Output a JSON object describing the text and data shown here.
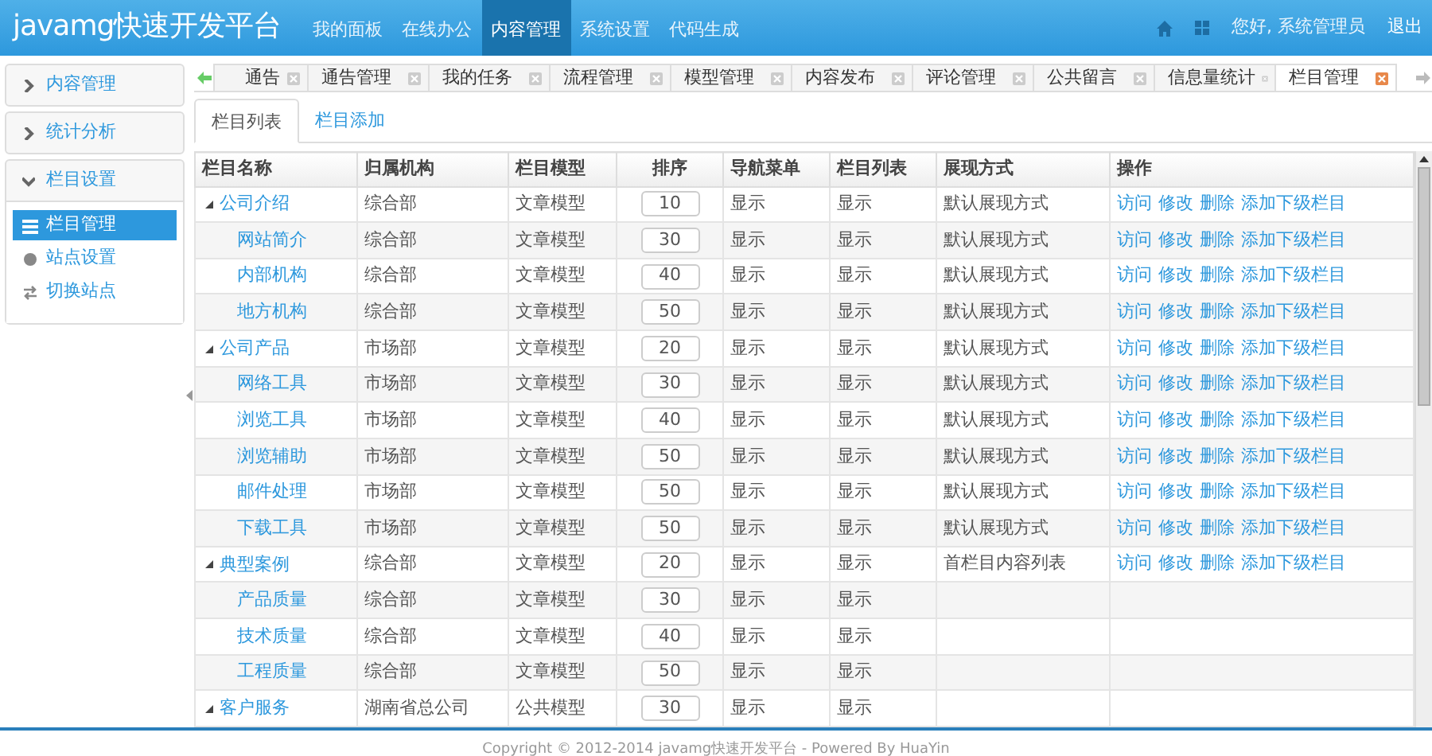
{
  "header": {
    "title": "javamg快速开发平台",
    "nav": [
      {
        "label": "我的面板",
        "selected": false
      },
      {
        "label": "在线办公",
        "selected": false
      },
      {
        "label": "内容管理",
        "selected": true
      },
      {
        "label": "系统设置",
        "selected": false
      },
      {
        "label": "代码生成",
        "selected": false
      }
    ],
    "greeting": "您好, 系统管理员",
    "logout": "退出"
  },
  "sidebar": {
    "panels": [
      {
        "label": "内容管理",
        "expanded": false
      },
      {
        "label": "统计分析",
        "expanded": false
      },
      {
        "label": "栏目设置",
        "expanded": true,
        "items": [
          {
            "label": "栏目管理",
            "selected": true
          },
          {
            "label": "站点设置",
            "selected": false
          },
          {
            "label": "切换站点",
            "selected": false
          }
        ]
      }
    ]
  },
  "tabs": [
    {
      "label": "通告",
      "selected": false
    },
    {
      "label": "通告管理",
      "selected": false
    },
    {
      "label": "我的任务",
      "selected": false
    },
    {
      "label": "流程管理",
      "selected": false
    },
    {
      "label": "模型管理",
      "selected": false
    },
    {
      "label": "内容发布",
      "selected": false
    },
    {
      "label": "评论管理",
      "selected": false
    },
    {
      "label": "公共留言",
      "selected": false
    },
    {
      "label": "信息量统计",
      "selected": false
    },
    {
      "label": "栏目管理",
      "selected": true
    }
  ],
  "subtabs": [
    {
      "label": "栏目列表",
      "selected": true
    },
    {
      "label": "栏目添加",
      "selected": false
    }
  ],
  "table": {
    "columns": [
      "栏目名称",
      "归属机构",
      "栏目模型",
      "排序",
      "导航菜单",
      "栏目列表",
      "展现方式",
      "操作"
    ],
    "rows": [
      {
        "name": "公司介绍",
        "org": "综合部",
        "model": "文章模型",
        "sort": "10",
        "nav": "显示",
        "list": "显示",
        "display": "默认展现方式",
        "ops": [
          "访问",
          "修改",
          "删除",
          "添加下级栏目"
        ],
        "expanded": true,
        "children": [
          {
            "name": "网站简介",
            "org": "综合部",
            "model": "文章模型",
            "sort": "30",
            "nav": "显示",
            "list": "显示",
            "display": "默认展现方式",
            "ops": [
              "访问",
              "修改",
              "删除",
              "添加下级栏目"
            ]
          },
          {
            "name": "内部机构",
            "org": "综合部",
            "model": "文章模型",
            "sort": "40",
            "nav": "显示",
            "list": "显示",
            "display": "默认展现方式",
            "ops": [
              "访问",
              "修改",
              "删除",
              "添加下级栏目"
            ]
          },
          {
            "name": "地方机构",
            "org": "综合部",
            "model": "文章模型",
            "sort": "50",
            "nav": "显示",
            "list": "显示",
            "display": "默认展现方式",
            "ops": [
              "访问",
              "修改",
              "删除",
              "添加下级栏目"
            ]
          }
        ]
      },
      {
        "name": "公司产品",
        "org": "市场部",
        "model": "文章模型",
        "sort": "20",
        "nav": "显示",
        "list": "显示",
        "display": "默认展现方式",
        "ops": [
          "访问",
          "修改",
          "删除",
          "添加下级栏目"
        ],
        "expanded": true,
        "children": [
          {
            "name": "网络工具",
            "org": "市场部",
            "model": "文章模型",
            "sort": "30",
            "nav": "显示",
            "list": "显示",
            "display": "默认展现方式",
            "ops": [
              "访问",
              "修改",
              "删除",
              "添加下级栏目"
            ]
          },
          {
            "name": "浏览工具",
            "org": "市场部",
            "model": "文章模型",
            "sort": "40",
            "nav": "显示",
            "list": "显示",
            "display": "默认展现方式",
            "ops": [
              "访问",
              "修改",
              "删除",
              "添加下级栏目"
            ]
          },
          {
            "name": "浏览辅助",
            "org": "市场部",
            "model": "文章模型",
            "sort": "50",
            "nav": "显示",
            "list": "显示",
            "display": "默认展现方式",
            "ops": [
              "访问",
              "修改",
              "删除",
              "添加下级栏目"
            ]
          },
          {
            "name": "邮件处理",
            "org": "市场部",
            "model": "文章模型",
            "sort": "50",
            "nav": "显示",
            "list": "显示",
            "display": "默认展现方式",
            "ops": [
              "访问",
              "修改",
              "删除",
              "添加下级栏目"
            ]
          },
          {
            "name": "下载工具",
            "org": "市场部",
            "model": "文章模型",
            "sort": "50",
            "nav": "显示",
            "list": "显示",
            "display": "默认展现方式",
            "ops": [
              "访问",
              "修改",
              "删除",
              "添加下级栏目"
            ]
          }
        ]
      },
      {
        "name": "典型案例",
        "org": "综合部",
        "model": "文章模型",
        "sort": "20",
        "nav": "显示",
        "list": "显示",
        "display": "首栏目内容列表",
        "ops": [
          "访问",
          "修改",
          "删除",
          "添加下级栏目"
        ],
        "expanded": true,
        "children": [
          {
            "name": "产品质量",
            "org": "综合部",
            "model": "文章模型",
            "sort": "30",
            "nav": "显示",
            "list": "显示"
          },
          {
            "name": "技术质量",
            "org": "综合部",
            "model": "文章模型",
            "sort": "40",
            "nav": "显示",
            "list": "显示"
          },
          {
            "name": "工程质量",
            "org": "综合部",
            "model": "文章模型",
            "sort": "50",
            "nav": "显示",
            "list": "显示"
          }
        ]
      },
      {
        "name": "客户服务",
        "org": "湖南省总公司",
        "model": "公共模型",
        "sort": "30",
        "nav": "显示",
        "list": "显示",
        "expanded": true
      }
    ]
  },
  "footer": "Copyright © 2012-2014 javamg快速开发平台 - Powered By HuaYin"
}
